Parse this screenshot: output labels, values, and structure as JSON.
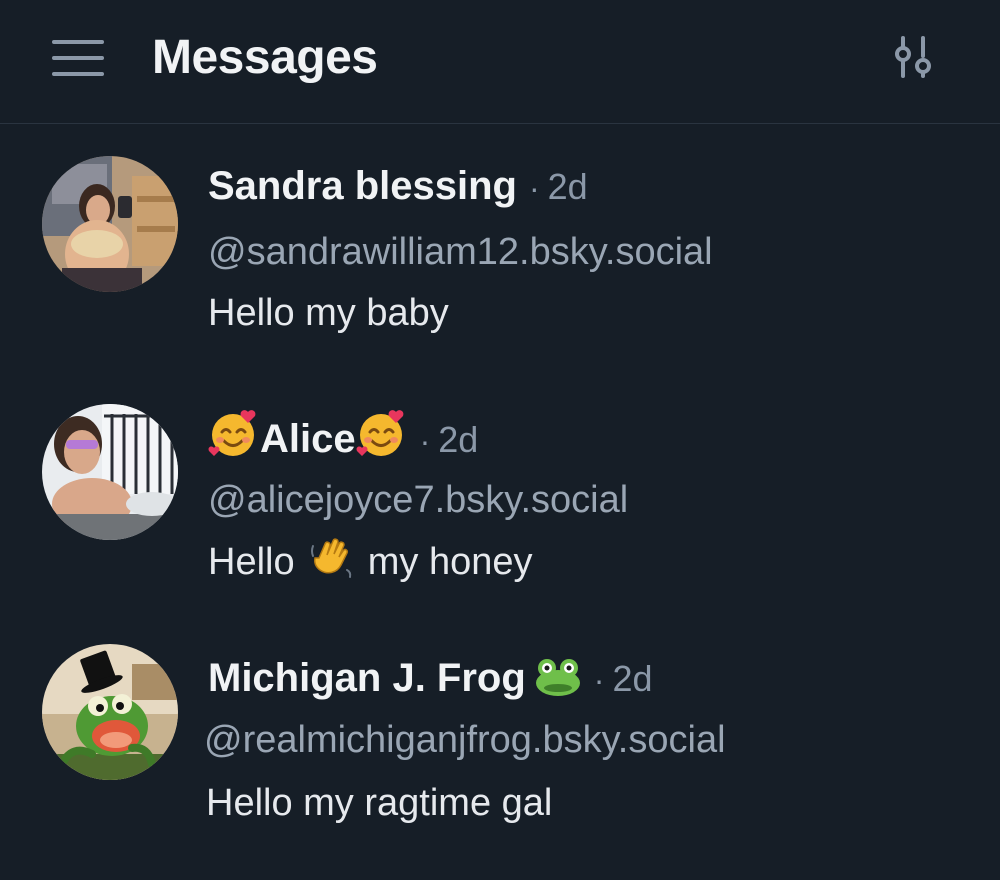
{
  "header": {
    "title": "Messages",
    "menu_icon": "hamburger-menu-icon",
    "settings_icon": "settings-sliders-icon"
  },
  "conversations": [
    {
      "name": "Sandra blessing",
      "separator": "·",
      "time": "2d",
      "handle": "@sandrawilliam12.bsky.social",
      "preview": "Hello my baby"
    },
    {
      "name": "Alice",
      "name_emoji": "smiling-face-with-hearts",
      "separator": "·",
      "time": "2d",
      "handle": "@alicejoyce7.bsky.social",
      "preview_before": "Hello",
      "preview_emoji": "waving-hand",
      "preview_after": "my honey"
    },
    {
      "name": "Michigan J. Frog",
      "name_emoji": "frog-face",
      "separator": "·",
      "time": "2d",
      "handle": "@realmichiganjfrog.bsky.social",
      "preview": "Hello my ragtime gal"
    }
  ],
  "colors": {
    "background": "#161e27",
    "text_primary": "#f1f3f5",
    "text_secondary": "#9aa6b4",
    "divider": "#2a3440"
  }
}
